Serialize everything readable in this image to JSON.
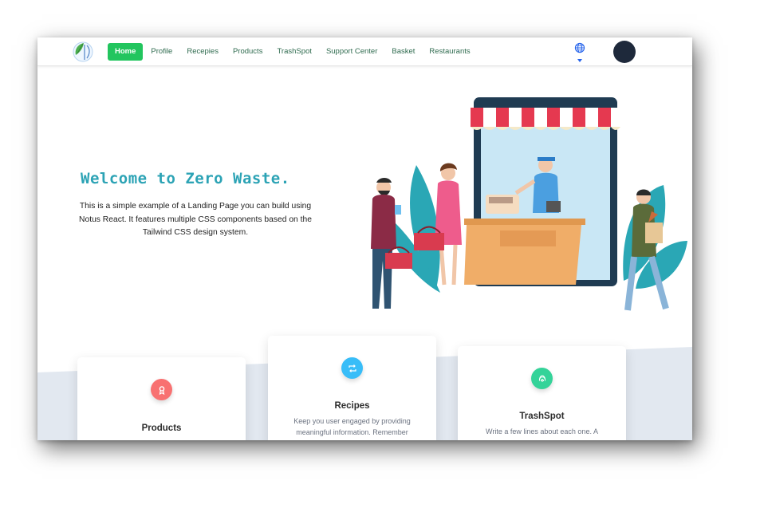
{
  "nav": {
    "items": [
      {
        "label": "Home",
        "active": true
      },
      {
        "label": "Profile"
      },
      {
        "label": "Recepies"
      },
      {
        "label": "Products"
      },
      {
        "label": "TrashSpot"
      },
      {
        "label": "Support Center"
      },
      {
        "label": "Basket"
      },
      {
        "label": "Restaurants"
      }
    ],
    "language_icon": "globe-icon",
    "active_color": "#22c55e"
  },
  "hero": {
    "title": "Welcome to Zero Waste.",
    "text": "This is a simple example of a Landing Page you can build using Notus React. It features multiple CSS components based on the Tailwind CSS design system.",
    "title_color": "#2ca3b5"
  },
  "cards": [
    {
      "title": "Products",
      "text": "",
      "icon": "award-icon",
      "icon_color": "#f87171"
    },
    {
      "title": "Recipes",
      "text": "Keep you user engaged by providing meaningful information. Remember",
      "icon": "retweet-icon",
      "icon_color": "#38bdf8"
    },
    {
      "title": "TrashSpot",
      "text": "Write a few lines about each one. A",
      "icon": "fingerprint-icon",
      "icon_color": "#34d399"
    }
  ]
}
